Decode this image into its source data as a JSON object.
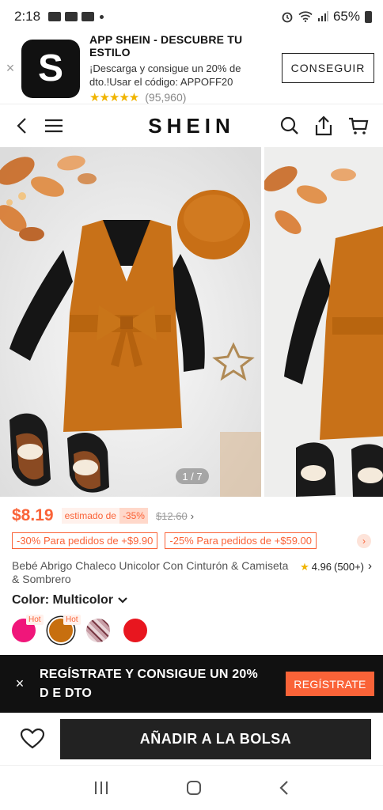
{
  "status_bar": {
    "time": "2:18",
    "battery": "65%"
  },
  "app_banner": {
    "close": "×",
    "logo_letter": "S",
    "title": "APP SHEIN - DESCUBRE TU ESTILO",
    "description": "¡Descarga y consigue un 20% de dto.!Usar el código: APPOFF20",
    "stars": "★★★★★",
    "rating_count": "(95,960)",
    "button": "CONSEGUIR"
  },
  "nav": {
    "brand": "SHEIN",
    "icons": [
      "back-icon",
      "menu-icon",
      "search-icon",
      "share-icon",
      "cart-icon"
    ]
  },
  "gallery": {
    "counter": "1 / 7"
  },
  "price": {
    "current": "$8.19",
    "estimate_label": "estimado de",
    "discount": "-35%",
    "original": "$12.60",
    "chevron": "›"
  },
  "promos": [
    "-30% Para pedidos de +$9.90",
    "-25% Para pedidos de +$59.00"
  ],
  "product": {
    "title": "Bebé Abrigo Chaleco Unicolor Con Cinturón & Camiseta & Sombrero",
    "rating": "4.96",
    "rating_count": "(500+)",
    "rating_chevron": "›"
  },
  "color": {
    "label": "Color: Multicolor",
    "caret": "▼",
    "swatches": [
      {
        "color": "#f0167a",
        "hot": "Hot"
      },
      {
        "color": "#c76f0f",
        "hot": "Hot",
        "selected": true
      },
      {
        "color": "#c9a0a8",
        "hot": ""
      },
      {
        "color": "#e8161f",
        "hot": ""
      }
    ]
  },
  "register_banner": {
    "close": "×",
    "text": "REGÍSTRATE Y CONSIGUE UN 20% D E DTO",
    "button": "REGÍSTRATE"
  },
  "buy_bar": {
    "add_button": "AÑADIR A LA BOLSA"
  },
  "colors": {
    "accent": "#fa6338",
    "dark": "#222222",
    "star": "#f0b400"
  }
}
